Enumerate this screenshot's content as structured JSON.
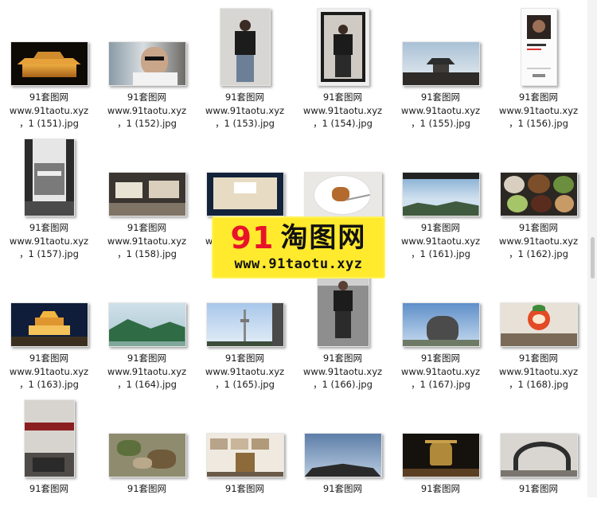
{
  "files": [
    {
      "name": "91套图网",
      "site": "www.91taotu.xyz",
      "file": "，1 (151).jpg",
      "shape": "landscape",
      "art": "temple-night"
    },
    {
      "name": "91套图网",
      "site": "www.91taotu.xyz",
      "file": "，1 (152).jpg",
      "shape": "landscape",
      "art": "car-selfie"
    },
    {
      "name": "91套图网",
      "site": "www.91taotu.xyz",
      "file": "，1 (153).jpg",
      "shape": "portrait",
      "art": "mirror-man"
    },
    {
      "name": "91套图网",
      "site": "www.91taotu.xyz",
      "file": "，1 (154).jpg",
      "shape": "portrait2",
      "art": "mirror-man-dark"
    },
    {
      "name": "91套图网",
      "site": "www.91taotu.xyz",
      "file": "，1 (155).jpg",
      "shape": "landscape",
      "art": "pagoda-sky"
    },
    {
      "name": "91套图网",
      "site": "www.91taotu.xyz",
      "file": "，1 (156).jpg",
      "shape": "phone",
      "art": "music-app"
    },
    {
      "name": "91套图网",
      "site": "www.91taotu.xyz",
      "file": "，1 (157).jpg",
      "shape": "portrait",
      "art": "courtyard-bw"
    },
    {
      "name": "91套图网",
      "site": "www.91taotu.xyz",
      "file": "，1 (158).jpg",
      "shape": "landscape",
      "art": "museum-hall"
    },
    {
      "name": "91套图网",
      "site": "www.91taotu.xyz",
      "file": "",
      "shape": "landscape",
      "art": "museum-case"
    },
    {
      "name": "91套图网",
      "site": "",
      "file": "",
      "shape": "landscape",
      "art": "food-plate"
    },
    {
      "name": "91套图网",
      "site": "www.91taotu.xyz",
      "file": "，1 (161).jpg",
      "shape": "landscape",
      "art": "mountain-view"
    },
    {
      "name": "91套图网",
      "site": "www.91taotu.xyz",
      "file": "，1 (162).jpg",
      "shape": "landscape",
      "art": "dishes"
    },
    {
      "name": "91套图网",
      "site": "www.91taotu.xyz",
      "file": "，1 (163).jpg",
      "shape": "landscape",
      "art": "bell-tower"
    },
    {
      "name": "91套图网",
      "site": "www.91taotu.xyz",
      "file": "，1 (164).jpg",
      "shape": "landscape",
      "art": "green-hills"
    },
    {
      "name": "91套图网",
      "site": "www.91taotu.xyz",
      "file": "，1 (165).jpg",
      "shape": "landscape",
      "art": "tower-sky"
    },
    {
      "name": "91套图网",
      "site": "www.91taotu.xyz",
      "file": "，1 (166).jpg",
      "shape": "portrait2",
      "art": "gym-man"
    },
    {
      "name": "91套图网",
      "site": "www.91taotu.xyz",
      "file": "，1 (167).jpg",
      "shape": "landscape",
      "art": "rock-sky"
    },
    {
      "name": "91套图网",
      "site": "www.91taotu.xyz",
      "file": "，1 (168).jpg",
      "shape": "landscape",
      "art": "mascot"
    },
    {
      "name": "91套图网",
      "site": "",
      "file": "",
      "shape": "portrait",
      "art": "station"
    },
    {
      "name": "91套图网",
      "site": "",
      "file": "",
      "shape": "landscape",
      "art": "herbs"
    },
    {
      "name": "91套图网",
      "site": "",
      "file": "",
      "shape": "landscape",
      "art": "exhibit-wall"
    },
    {
      "name": "91套图网",
      "site": "",
      "file": "",
      "shape": "landscape",
      "art": "roof-sky"
    },
    {
      "name": "91套图网",
      "site": "",
      "file": "",
      "shape": "landscape",
      "art": "bronze"
    },
    {
      "name": "91套图网",
      "site": "",
      "file": "",
      "shape": "landscape",
      "art": "staircase"
    }
  ],
  "watermark": {
    "num": "91",
    "cn": "淘图网",
    "url": "www.91taotu.xyz"
  }
}
